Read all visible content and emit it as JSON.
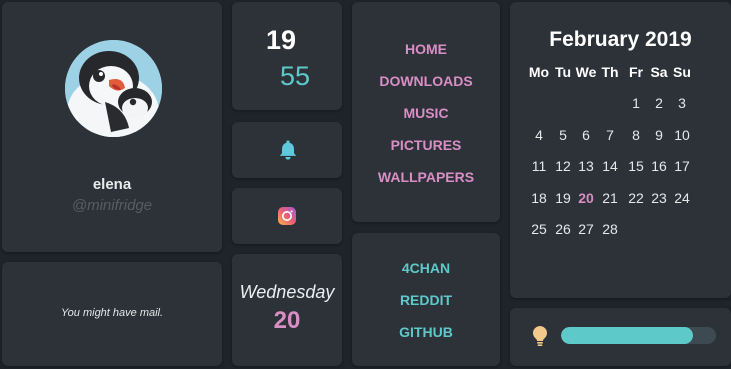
{
  "profile": {
    "username": "elena",
    "handle": "@minifridge"
  },
  "mail": {
    "text": "You might have mail."
  },
  "clock": {
    "hours": "19",
    "minutes": "55"
  },
  "day": {
    "weekday": "Wednesday",
    "number": "20"
  },
  "nav": {
    "items": [
      "HOME",
      "DOWNLOADS",
      "MUSIC",
      "PICTURES",
      "WALLPAPERS"
    ]
  },
  "links": {
    "items": [
      "4CHAN",
      "REDDIT",
      "GITHUB"
    ]
  },
  "calendar": {
    "title": "February 2019",
    "weekdays": [
      "Mo",
      "Tu",
      "We",
      "Th",
      "Fr",
      "Sa",
      "Su"
    ],
    "first_weekday_index": 4,
    "days_in_month": 28,
    "today": 20
  },
  "brightness": {
    "level": 0.85
  },
  "icons": {
    "bell": "bell-icon",
    "instagram": "instagram-icon",
    "bulb": "lightbulb-icon"
  },
  "colors": {
    "accent_pink": "#d98ec3",
    "accent_teal": "#5ec9c9",
    "tile": "#2c3238",
    "background": "#1f242a"
  }
}
